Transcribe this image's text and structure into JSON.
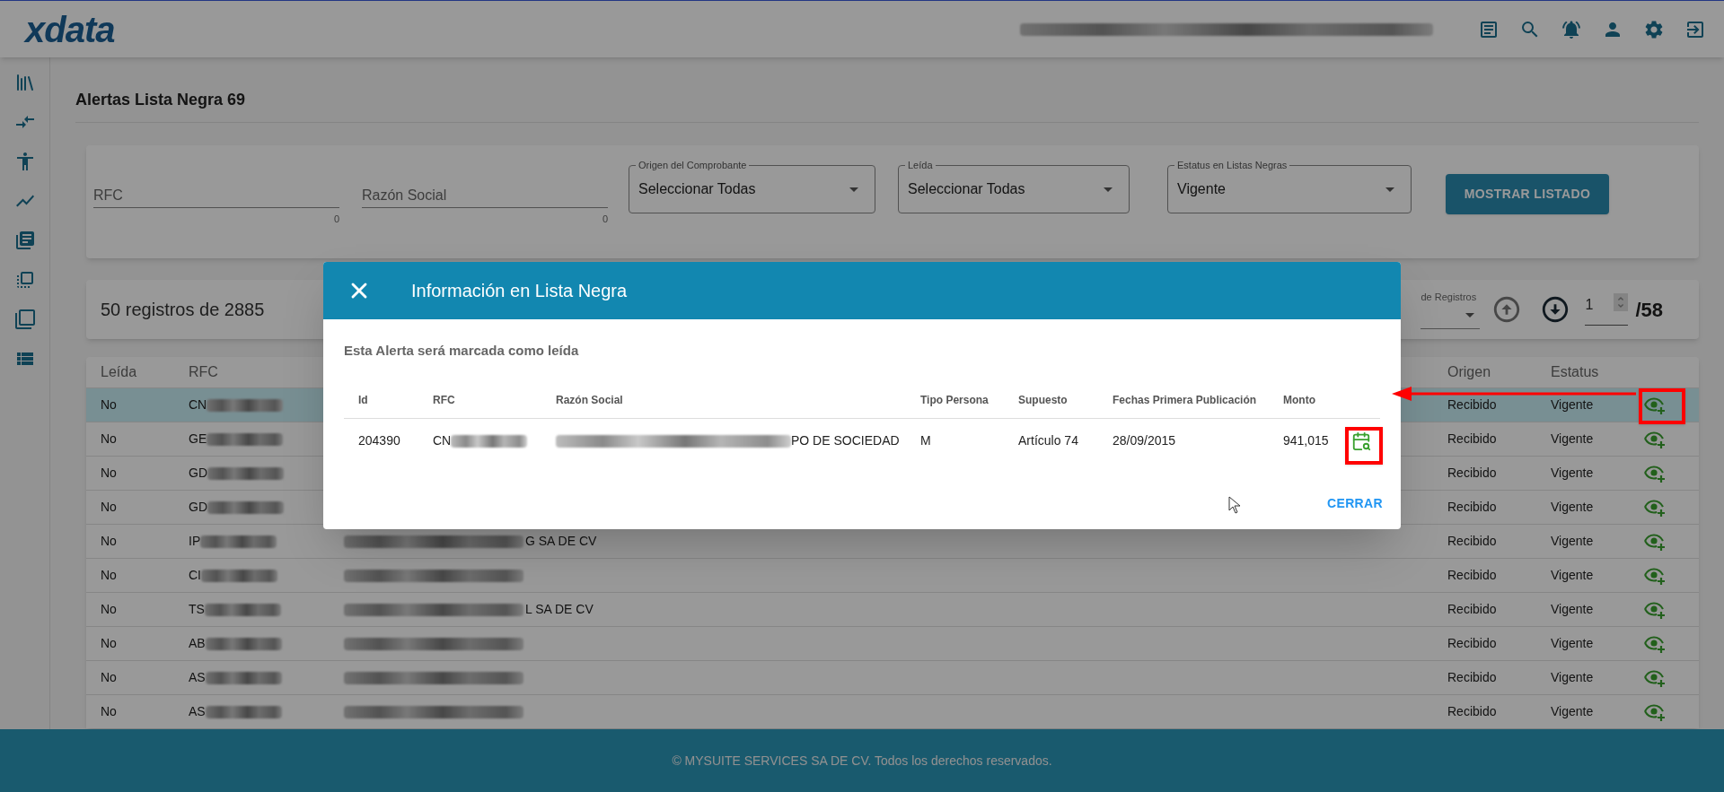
{
  "header": {
    "logo": "xdata"
  },
  "page": {
    "title": "Alertas Lista Negra 69"
  },
  "filters": {
    "text_fields": [
      {
        "placeholder": "RFC",
        "counter": "0"
      },
      {
        "placeholder": "Razón Social",
        "counter": "0"
      }
    ],
    "selects": [
      {
        "label": "Origen del Comprobante",
        "value": "Seleccionar Todas"
      },
      {
        "label": "Leída",
        "value": "Seleccionar Todas"
      },
      {
        "label": "Estatus en Listas Negras",
        "value": "Vigente"
      }
    ],
    "button": "MOSTRAR LISTADO"
  },
  "records": {
    "summary": "50 registros de 2885",
    "page_size_label": "de Registros",
    "page": "1",
    "total_pages": "/58"
  },
  "table": {
    "columns": [
      "Leída",
      "RFC",
      "Origen",
      "Estatus"
    ],
    "rows": [
      {
        "leida": "No",
        "rfc": "CN",
        "razon_redacted": false,
        "origen": "Recibido",
        "estatus": "Vigente",
        "selected": true
      },
      {
        "leida": "No",
        "rfc": "GE",
        "razon_redacted": false,
        "origen": "Recibido",
        "estatus": "Vigente",
        "selected": false
      },
      {
        "leida": "No",
        "rfc": "GD",
        "razon_redacted": false,
        "origen": "Recibido",
        "estatus": "Vigente",
        "selected": false
      },
      {
        "leida": "No",
        "rfc": "GD",
        "razon_redacted": false,
        "origen": "Recibido",
        "estatus": "Vigente",
        "selected": false
      },
      {
        "leida": "No",
        "rfc": "IP",
        "razon_redacted": true,
        "razon_social": "G SA DE CV",
        "origen": "Recibido",
        "estatus": "Vigente",
        "selected": false
      },
      {
        "leida": "No",
        "rfc": "CI",
        "razon_redacted": true,
        "origen": "Recibido",
        "estatus": "Vigente",
        "selected": false
      },
      {
        "leida": "No",
        "rfc": "TS",
        "razon_redacted": true,
        "razon_social": "L SA DE CV",
        "origen": "Recibido",
        "estatus": "Vigente",
        "selected": false
      },
      {
        "leida": "No",
        "rfc": "AB",
        "razon_redacted": true,
        "origen": "Recibido",
        "estatus": "Vigente",
        "selected": false
      },
      {
        "leida": "No",
        "rfc": "AS",
        "razon_redacted": true,
        "origen": "Recibido",
        "estatus": "Vigente",
        "selected": false
      },
      {
        "leida": "No",
        "rfc": "AS",
        "razon_redacted": true,
        "origen": "Recibido",
        "estatus": "Vigente",
        "selected": false
      }
    ]
  },
  "modal": {
    "title": "Información en Lista Negra",
    "message": "Esta Alerta será marcada como leída",
    "columns": [
      "Id",
      "RFC",
      "Razón Social",
      "Tipo Persona",
      "Supuesto",
      "Fechas Primera Publicación",
      "Monto"
    ],
    "row": {
      "id": "204390",
      "rfc": "CN",
      "razon_social": "PO DE SOCIEDAD",
      "tipo": "M",
      "supuesto": "Artículo 74",
      "fecha": "28/09/2015",
      "monto": "941,015"
    },
    "close_label": "CERRAR"
  },
  "footer": "© MYSUITE SERVICES SA DE CV. Todos los derechos reservados."
}
